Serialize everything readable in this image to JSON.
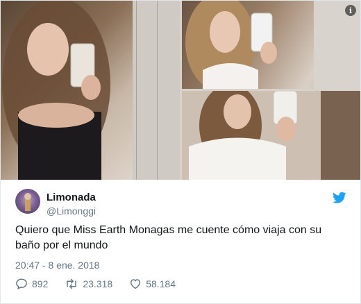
{
  "media": {
    "photos": [
      {
        "name": "photo-1"
      },
      {
        "name": "photo-2"
      },
      {
        "name": "photo-3"
      }
    ],
    "info_icon": "info-icon",
    "info_glyph": "i"
  },
  "tweet": {
    "author_name": "Limonada",
    "author_handle": "@Limonggi",
    "text": "Quiero que Miss Earth Monagas me cuente cómo viaja con su baño por el mundo",
    "timestamp": "20:47 - 8 ene. 2018",
    "replies": "892",
    "retweets": "23.318",
    "likes": "58.184"
  },
  "colors": {
    "twitter_blue": "#1da1f2",
    "muted": "#657786",
    "text": "#14171a",
    "border": "#e1e8ed"
  },
  "icons": [
    "info-icon",
    "twitter-bird-icon",
    "reply-icon",
    "retweet-icon",
    "like-icon"
  ]
}
